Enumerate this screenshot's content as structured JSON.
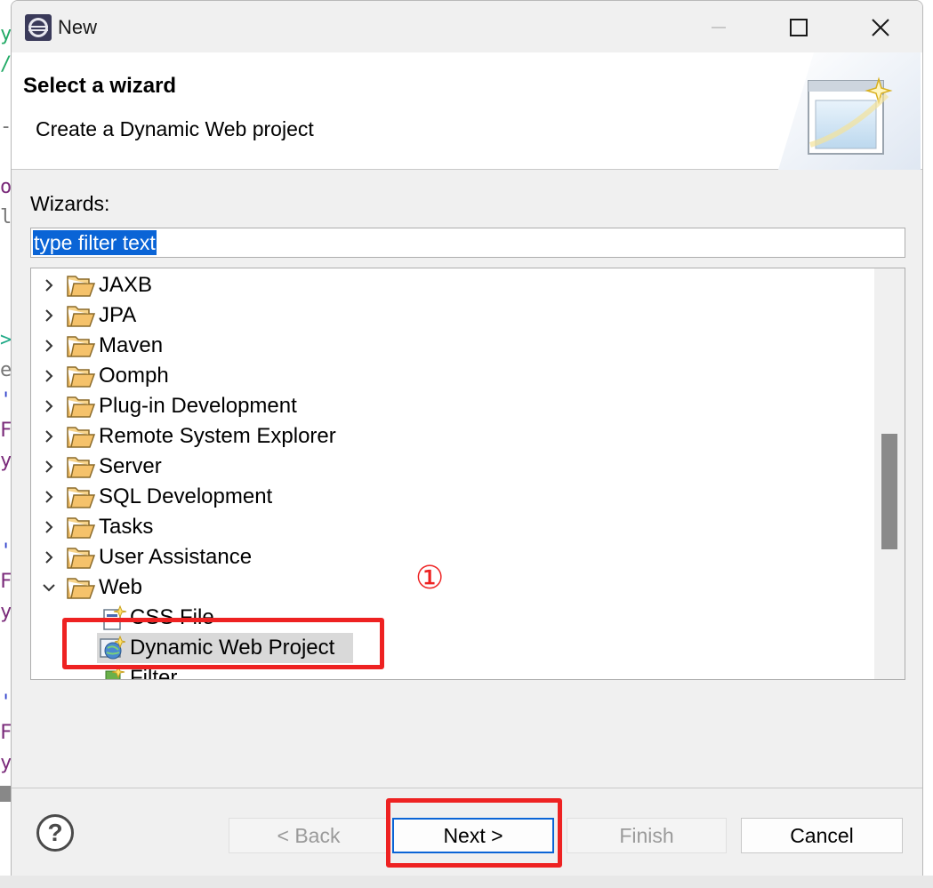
{
  "window": {
    "title": "New"
  },
  "header": {
    "title": "Select a wizard",
    "description": "Create a Dynamic Web project"
  },
  "wizards_label": "Wizards:",
  "filter": {
    "value": "type filter text"
  },
  "tree": {
    "folders": [
      {
        "label": "JAXB",
        "expanded": false
      },
      {
        "label": "JPA",
        "expanded": false
      },
      {
        "label": "Maven",
        "expanded": false
      },
      {
        "label": "Oomph",
        "expanded": false
      },
      {
        "label": "Plug-in Development",
        "expanded": false
      },
      {
        "label": "Remote System Explorer",
        "expanded": false
      },
      {
        "label": "Server",
        "expanded": false
      },
      {
        "label": "SQL Development",
        "expanded": false
      },
      {
        "label": "Tasks",
        "expanded": false
      },
      {
        "label": "User Assistance",
        "expanded": false
      },
      {
        "label": "Web",
        "expanded": true
      }
    ],
    "web_children": [
      {
        "label": "CSS File",
        "icon": "css-file-icon"
      },
      {
        "label": "Dynamic Web Project",
        "icon": "dynamic-web-project-icon",
        "selected": true
      },
      {
        "label": "Filter",
        "icon": "filter-icon"
      }
    ]
  },
  "annotation": {
    "marker": "①",
    "color": "#ee2222"
  },
  "buttons": {
    "back": "< Back",
    "next": "Next >",
    "finish": "Finish",
    "cancel": "Cancel"
  },
  "colors": {
    "selection": "#0a64d6",
    "folder": "#f5c26b",
    "annotation": "#ee2222"
  }
}
